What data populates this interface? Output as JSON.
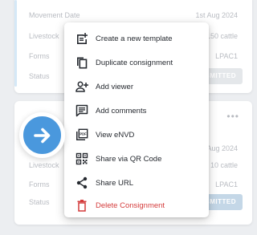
{
  "card1": {
    "rows": [
      {
        "label": "Movement Date",
        "value": "1st Aug 2024"
      },
      {
        "label": "Livestock",
        "value": "150 cattle"
      },
      {
        "label": "Forms",
        "value": "LPAC1"
      },
      {
        "label": "Status",
        "value": ""
      }
    ],
    "status_pill": "SUBMITTED"
  },
  "card2": {
    "more_label": "•••",
    "rows": [
      {
        "label": "",
        "value": "1st Aug 2024"
      },
      {
        "label": "Livestock",
        "value": "10 cattle"
      },
      {
        "label": "Forms",
        "value": "LPAC1"
      },
      {
        "label": "Status",
        "value": ""
      }
    ],
    "status_pill": "SUBMITTED"
  },
  "menu": {
    "items": [
      {
        "label": "Create a new template",
        "icon": "post-add-icon"
      },
      {
        "label": "Duplicate consignment",
        "icon": "copy-icon"
      },
      {
        "label": "Add viewer",
        "icon": "person-add-icon"
      },
      {
        "label": "Add comments",
        "icon": "comment-icon"
      },
      {
        "label": "View eNVD",
        "icon": "pdf-icon"
      },
      {
        "label": "Share via QR Code",
        "icon": "qr-code-icon"
      },
      {
        "label": "Share URL",
        "icon": "share-icon"
      },
      {
        "label": "Delete Consignment",
        "icon": "delete-icon"
      }
    ],
    "pdf_icon_text": "PDF"
  },
  "colors": {
    "accent": "#4a98dd",
    "danger": "#d43c3c",
    "menu_text": "#262a30",
    "muted_text": "#b9bcc2"
  }
}
